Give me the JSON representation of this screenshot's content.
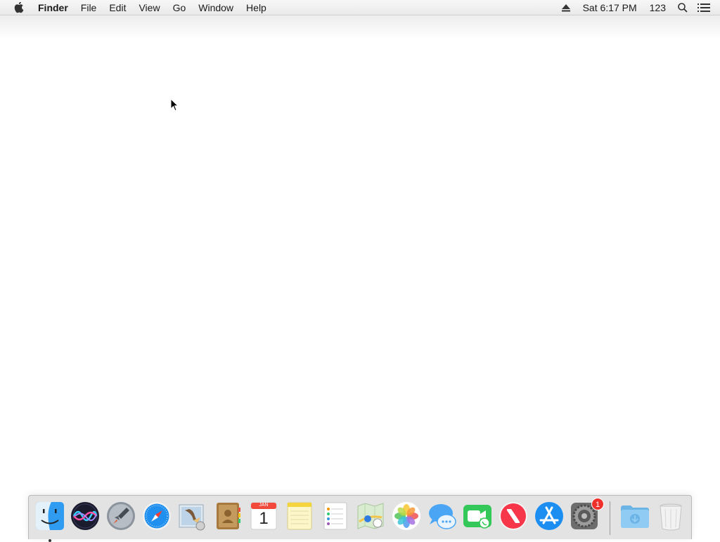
{
  "menubar": {
    "app_name": "Finder",
    "menus": [
      "File",
      "Edit",
      "View",
      "Go",
      "Window",
      "Help"
    ],
    "clock": "Sat 6:17 PM",
    "input_source": "123"
  },
  "dock": {
    "items": [
      {
        "name": "Finder",
        "icon": "finder-icon",
        "running": true
      },
      {
        "name": "Siri",
        "icon": "siri-icon"
      },
      {
        "name": "Launchpad",
        "icon": "launchpad-icon"
      },
      {
        "name": "Safari",
        "icon": "safari-icon"
      },
      {
        "name": "Mail",
        "icon": "mail-icon"
      },
      {
        "name": "Contacts",
        "icon": "contacts-icon"
      },
      {
        "name": "Calendar",
        "icon": "calendar-icon",
        "month": "JAN",
        "day": "1"
      },
      {
        "name": "Notes",
        "icon": "notes-icon"
      },
      {
        "name": "Reminders",
        "icon": "reminders-icon"
      },
      {
        "name": "Maps",
        "icon": "maps-icon"
      },
      {
        "name": "Photos",
        "icon": "photos-icon"
      },
      {
        "name": "Messages",
        "icon": "messages-icon"
      },
      {
        "name": "FaceTime",
        "icon": "facetime-icon"
      },
      {
        "name": "News",
        "icon": "news-icon"
      },
      {
        "name": "App Store",
        "icon": "app-store-icon"
      },
      {
        "name": "System Preferences",
        "icon": "system-preferences-icon",
        "badge": "1"
      },
      {
        "name": "Downloads",
        "icon": "downloads-folder-icon"
      },
      {
        "name": "Trash",
        "icon": "trash-icon"
      }
    ]
  }
}
